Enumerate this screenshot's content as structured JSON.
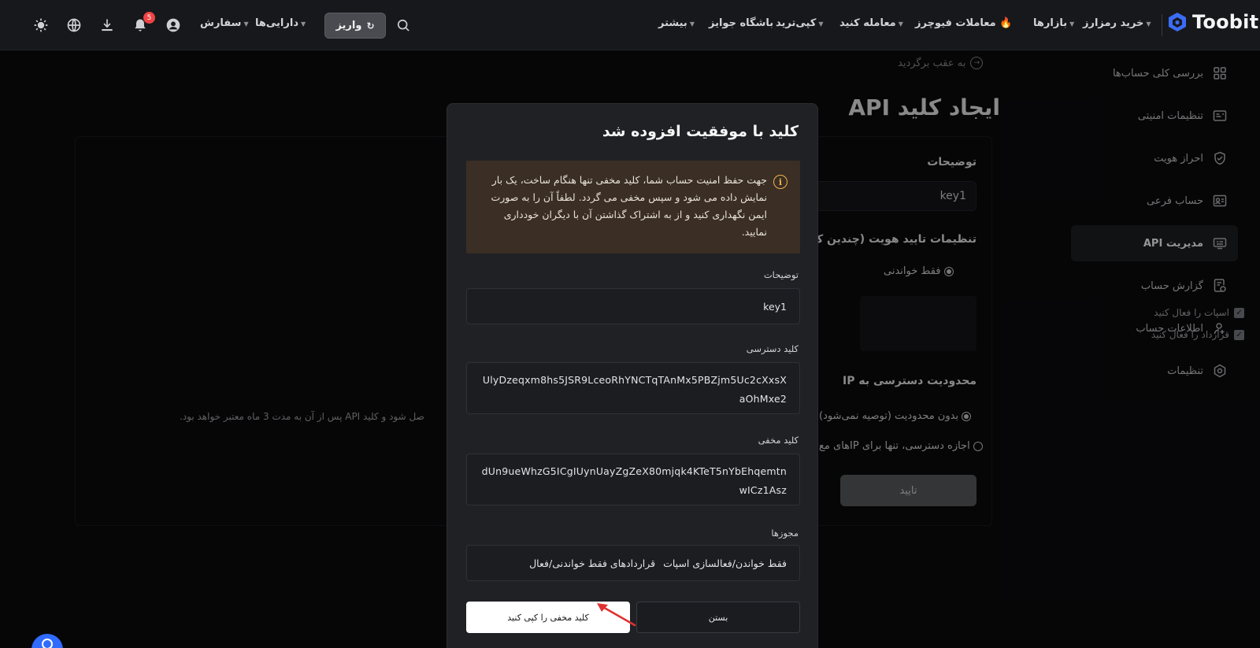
{
  "brand": {
    "name": "Toobit"
  },
  "nav": {
    "items": [
      {
        "label": "خرید رمزارز",
        "caret": true
      },
      {
        "label": "بازارها",
        "caret": true
      },
      {
        "label": "معاملات فیوچرز",
        "caret": false,
        "hot": true
      },
      {
        "label": "معامله کنید",
        "caret": true
      },
      {
        "label": "کپی‌ترید",
        "caret": true
      },
      {
        "label": "باشگاه جوایز",
        "caret": false
      },
      {
        "label": "بیشتر",
        "caret": true
      }
    ],
    "deposit_label": "واریز",
    "assets_label": "دارایی‌ها",
    "orders_label": "سفارش",
    "notification_count": "5"
  },
  "sidebar": {
    "items": [
      {
        "label": "بررسی کلی حساب‌ها",
        "icon": "dashboard-icon"
      },
      {
        "label": "تنظیمات امنیتی",
        "icon": "id-card-icon"
      },
      {
        "label": "احراز هویت",
        "icon": "shield-check-icon"
      },
      {
        "label": "حساب فرعی",
        "icon": "sub-account-icon"
      },
      {
        "label": "مدیریت API",
        "icon": "api-icon",
        "active": true
      },
      {
        "label": "گزارش حساب",
        "icon": "report-icon"
      },
      {
        "label": "اطلاعات حساب",
        "icon": "user-settings-icon"
      },
      {
        "label": "تنظیمات",
        "icon": "gear-icon"
      }
    ]
  },
  "page": {
    "back_label": "به عقب برگردید",
    "title": "ایجاد کلید API",
    "description_label": "توضیحات",
    "description_value": "key1",
    "verification_label": "تنظیمات تایید هویت (چندین ک",
    "read_only_label": "فقط خواندنی",
    "spot_check_label": "اسپات را فعال کنید",
    "contract_check_label": "قرارداد را فعال کنید",
    "ip_label": "محدودیت دسترسی به IP",
    "ip_unrestricted_label": "بدون محدودیت (توصیه نمی‌شود)",
    "ip_restricted_label": "اجازه دسترسی، تنها برای IPهای مع",
    "hint_text": "صل شود و کلید API پس از آن به مدت 3 ماه معتبر خواهد بود.",
    "confirm_label": "تایید"
  },
  "modal": {
    "title": "کلید با موفقیت افزوده شد",
    "warning": "جهت حفظ امنیت حساب شما، کلید مخفی تنها هنگام ساخت، یک بار نمایش داده می شود و سپس مخفی می گردد. لطفاً آن را به صورت ایمن نگهداری کنید و از به اشتراک گذاشتن آن با دیگران خودداری نمایید.",
    "description_label": "توضیحات",
    "description_value": "key1",
    "access_key_label": "کلید دسترسی",
    "access_key_value": "UlyDzeqxm8hs5JSR9LceoRhYNCTqTAnMx5PBZjm5Uc2cXxsXaOhMxe2",
    "secret_key_label": "کلید مخفی",
    "secret_key_value": "dUn9ueWhzG5ICgIUynUayZgZeX80mjqk4KTeT5nYbEhqemtnwICz1Asz",
    "permissions_label": "مجوزها",
    "permissions": [
      "فقط خواندن/فعالسازی اسپات",
      "قراردادهای فقط خواندنی/فعال"
    ],
    "close_label": "بستن",
    "copy_label": "کلید مخفی را کپی کنید"
  },
  "colors": {
    "background": "#0b0b0d",
    "modal_bg": "#202125",
    "warning_bg": "#3a2e25",
    "warning_icon": "#f0b44b",
    "brand_blue": "#3b6cf6",
    "annotation_arrow": "#e03131"
  }
}
